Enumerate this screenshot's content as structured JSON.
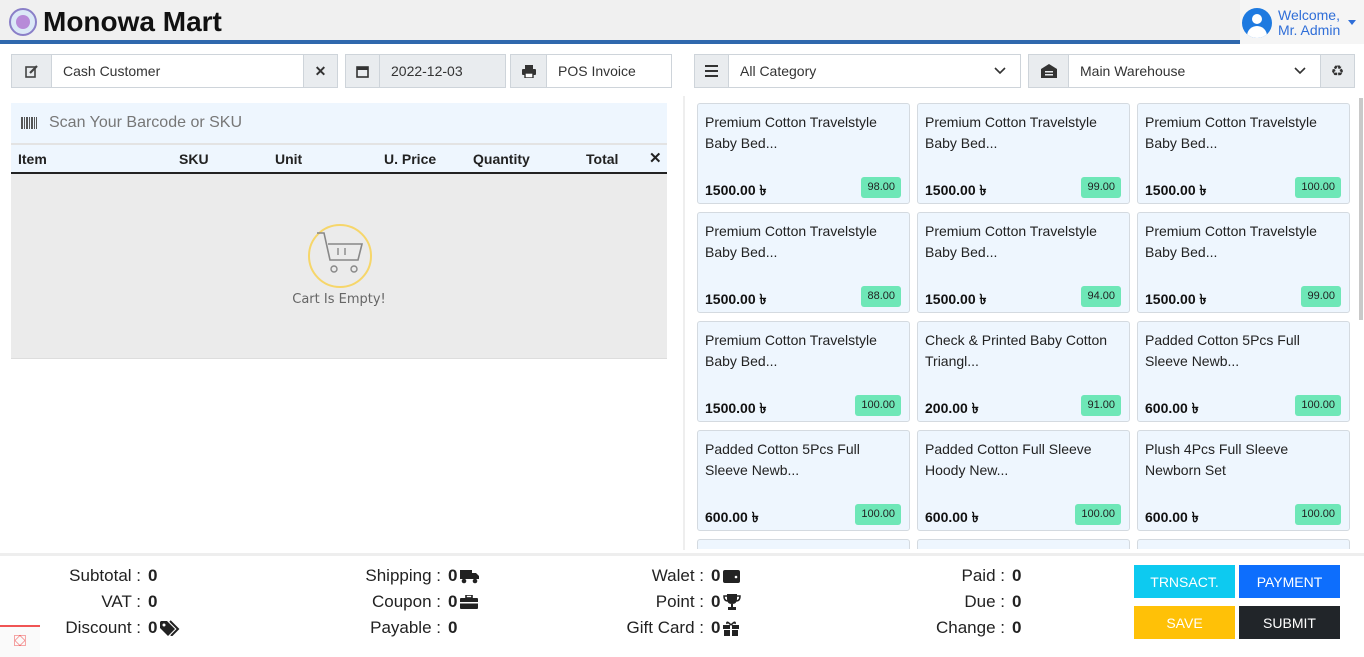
{
  "header": {
    "title": "Monowa Mart",
    "welcome_line1": "Welcome,",
    "welcome_line2": "Mr. Admin"
  },
  "toolbar": {
    "customer": "Cash Customer",
    "date": "2022-12-03",
    "invoice_type": "POS Invoice",
    "category": "All Category",
    "warehouse": "Main Warehouse"
  },
  "cart": {
    "scan_placeholder": "Scan Your Barcode or SKU",
    "columns": [
      "Item",
      "SKU",
      "Unit",
      "U. Price",
      "Quantity",
      "Total"
    ],
    "clear_symbol": "✕",
    "empty_text": "Cart Is Empty!"
  },
  "products": [
    {
      "name_l1": "Premium Cotton Travelstyle",
      "name_l2": "Baby Bed...",
      "price": "1500.00 ৳",
      "stock": "98.00"
    },
    {
      "name_l1": "Premium Cotton Travelstyle",
      "name_l2": "Baby Bed...",
      "price": "1500.00 ৳",
      "stock": "99.00"
    },
    {
      "name_l1": "Premium Cotton Travelstyle",
      "name_l2": "Baby Bed...",
      "price": "1500.00 ৳",
      "stock": "100.00"
    },
    {
      "name_l1": "Premium Cotton Travelstyle",
      "name_l2": "Baby Bed...",
      "price": "1500.00 ৳",
      "stock": "88.00"
    },
    {
      "name_l1": "Premium Cotton Travelstyle",
      "name_l2": "Baby Bed...",
      "price": "1500.00 ৳",
      "stock": "94.00"
    },
    {
      "name_l1": "Premium Cotton Travelstyle",
      "name_l2": "Baby Bed...",
      "price": "1500.00 ৳",
      "stock": "99.00"
    },
    {
      "name_l1": "Premium Cotton Travelstyle",
      "name_l2": "Baby Bed...",
      "price": "1500.00 ৳",
      "stock": "100.00"
    },
    {
      "name_l1": "Check & Printed Baby Cotton",
      "name_l2": "Triangl...",
      "price": "200.00 ৳",
      "stock": "91.00"
    },
    {
      "name_l1": "Padded Cotton 5Pcs Full",
      "name_l2": "Sleeve Newb...",
      "price": "600.00 ৳",
      "stock": "100.00"
    },
    {
      "name_l1": "Padded Cotton 5Pcs Full",
      "name_l2": "Sleeve Newb...",
      "price": "600.00 ৳",
      "stock": "100.00"
    },
    {
      "name_l1": "Padded Cotton Full Sleeve",
      "name_l2": "Hoody New...",
      "price": "600.00 ৳",
      "stock": "100.00"
    },
    {
      "name_l1": "Plush 4Pcs Full Sleeve",
      "name_l2": "Newborn Set",
      "price": "600.00 ৳",
      "stock": "100.00"
    }
  ],
  "summary": {
    "subtotal_label": "Subtotal :",
    "subtotal": "0",
    "vat_label": "VAT :",
    "vat": "0",
    "discount_label": "Discount :",
    "discount": "0",
    "shipping_label": "Shipping :",
    "shipping": "0",
    "coupon_label": "Coupon :",
    "coupon": "0",
    "payable_label": "Payable :",
    "payable": "0",
    "wallet_label": "Walet :",
    "wallet": "0",
    "point_label": "Point :",
    "point": "0",
    "giftcard_label": "Gift Card :",
    "giftcard": "0",
    "paid_label": "Paid :",
    "paid": "0",
    "due_label": "Due :",
    "due": "0",
    "change_label": "Change :",
    "change": "0"
  },
  "actions": {
    "transaction": "TRNSACT.",
    "payment": "PAYMENT",
    "save": "SAVE",
    "submit": "SUBMIT"
  },
  "colors": {
    "header_border": "#2f68ad",
    "stock_badge": "#6ee7b7",
    "transaction": "#0dcaf0",
    "payment": "#0d6efd",
    "save": "#ffc107",
    "submit": "#212529"
  }
}
